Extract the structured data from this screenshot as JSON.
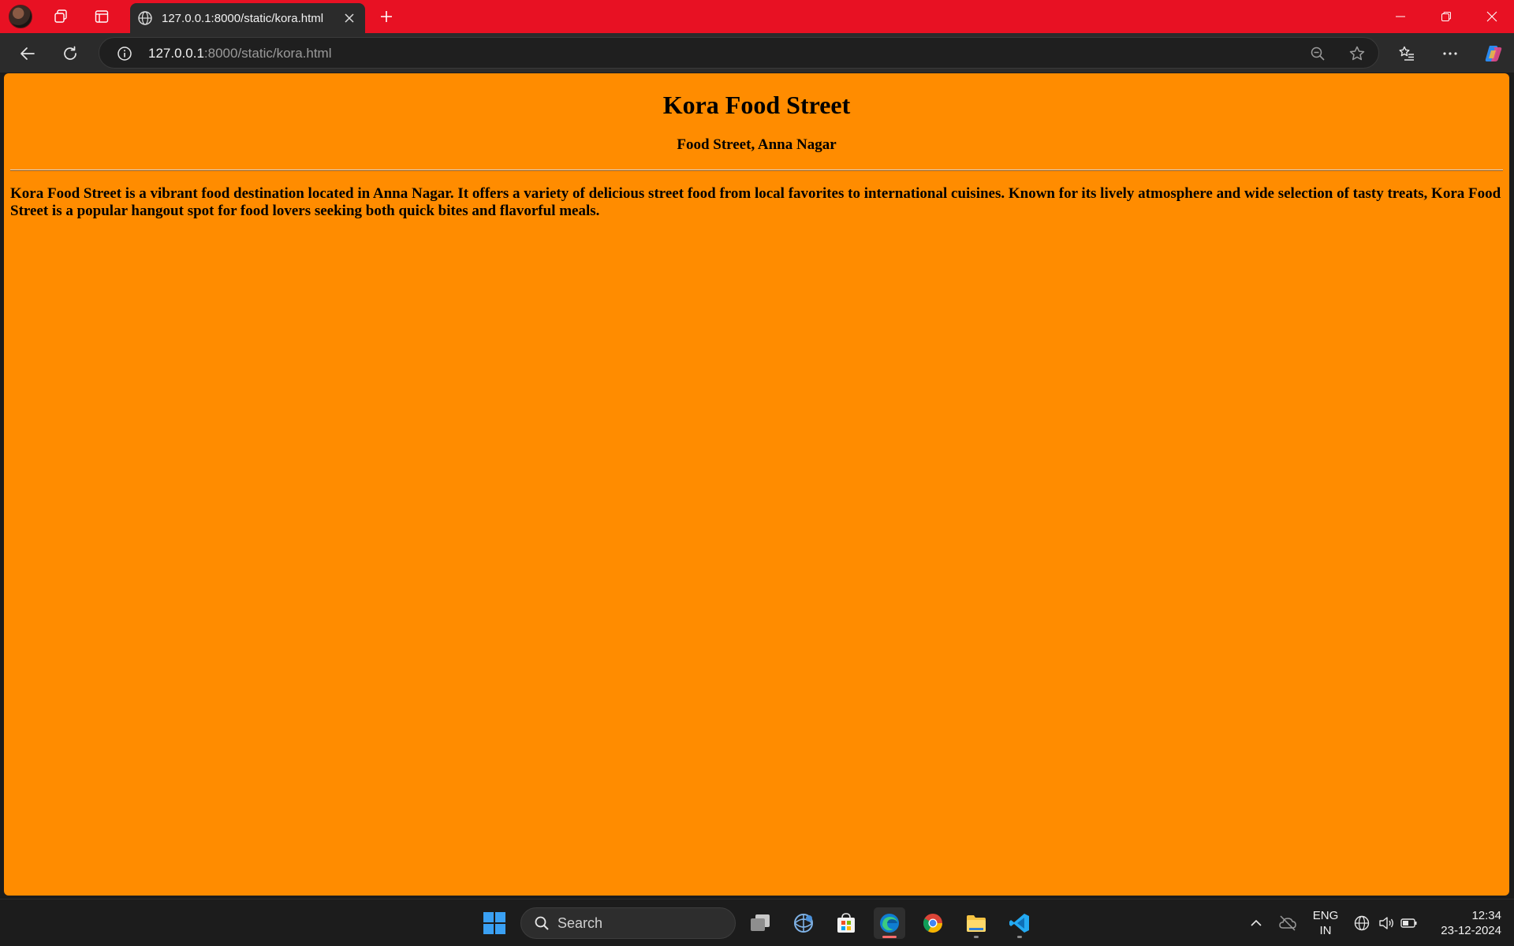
{
  "browser": {
    "tab": {
      "title": "127.0.0.1:8000/static/kora.html"
    },
    "address": {
      "host": "127.0.0.1",
      "rest": ":8000/static/kora.html"
    }
  },
  "page": {
    "title": "Kora Food Street",
    "subtitle": "Food Street, Anna Nagar",
    "description": "Kora Food Street is a vibrant food destination located in Anna Nagar. It offers a variety of delicious street food from local favorites to international cuisines. Known for its lively atmosphere and wide selection of tasty treats, Kora Food Street is a popular hangout spot for food lovers seeking both quick bites and flavorful meals.",
    "background_color": "#ff8c00"
  },
  "taskbar": {
    "search_label": "Search",
    "language": {
      "line1": "ENG",
      "line2": "IN"
    },
    "clock": {
      "time": "12:34",
      "date": "23-12-2024"
    }
  },
  "colors": {
    "tab_strip": "#e81123",
    "toolbar": "#2b2b2b",
    "taskbar": "#1c1c1c"
  },
  "icons": {
    "tabstrip": [
      "profile-avatar",
      "workspaces-icon",
      "vertical-tabs-icon",
      "globe-icon",
      "close-icon",
      "plus-icon"
    ],
    "window": [
      "minimize-icon",
      "restore-icon",
      "close-icon"
    ],
    "toolbar": [
      "back-arrow-icon",
      "reload-icon",
      "info-icon",
      "zoom-out-icon",
      "star-icon",
      "favorites-icon",
      "more-icon",
      "copilot-icon"
    ],
    "taskbar": [
      "windows-start-icon",
      "search-icon",
      "task-view-icon",
      "network-tool-icon",
      "store-icon",
      "edge-icon",
      "chrome-icon",
      "file-explorer-icon",
      "vscode-icon",
      "chevron-up-icon",
      "cloud-off-icon",
      "network-icon",
      "volume-icon",
      "battery-icon"
    ]
  }
}
